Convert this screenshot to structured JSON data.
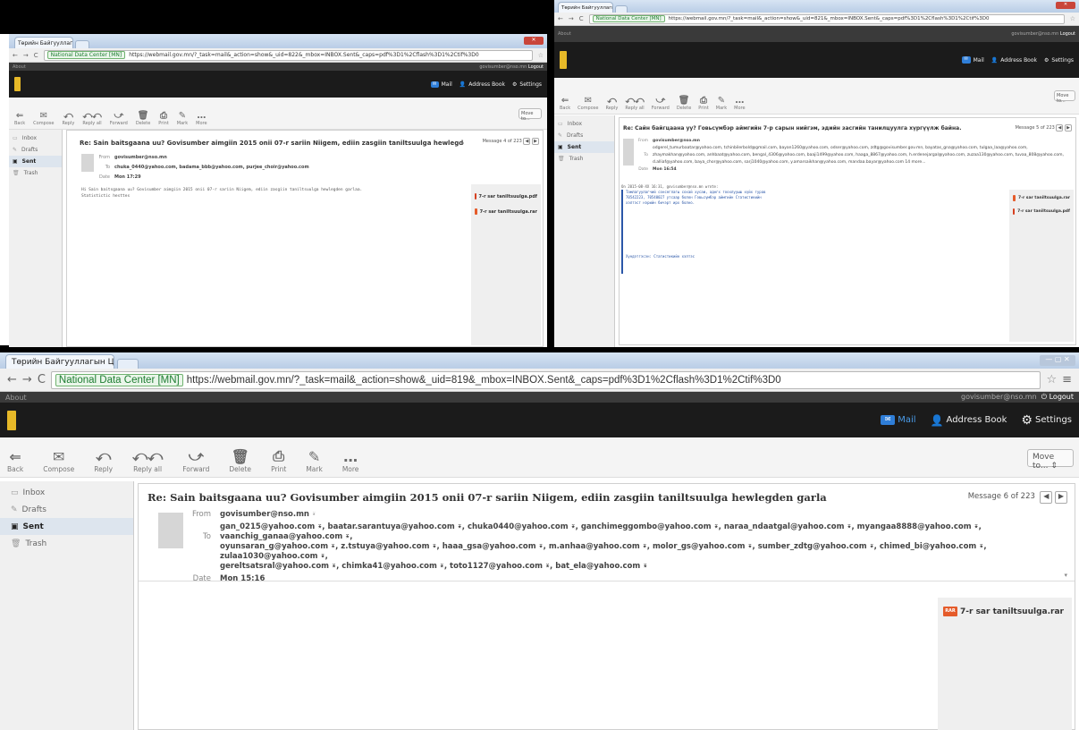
{
  "browser": {
    "tab_title": "Төрийн Байгууллагын Ц",
    "tab_close": "×",
    "url_secure_label": "National Data Center [MN]",
    "url": "https://webmail.gov.mn/?_task=mail&_action=show&_uid=819&_mbox=INBOX.Sent&_caps=pdf%3D1%2Cflash%3D1%2Ctif%3D0",
    "url_left": "https://webmail.gov.mn/?_task=mail&_action=show&_uid=822&_mbox=INBOX.Sent&_caps=pdf%3D1%2Cflash%3D1%2Ctif%3D0",
    "url_right": "https://webmail.gov.mn/?_task=mail&_action=show&_uid=821&_mbox=INBOX.Sent&_caps=pdf%3D1%2Cflash%3D1%2Ctif%3D0"
  },
  "app": {
    "about": "About",
    "user": "govisumber@nso.mn",
    "logout": "Logout",
    "nav": {
      "mail": "Mail",
      "address_book": "Address Book",
      "settings": "Settings"
    }
  },
  "toolbar": {
    "back": "Back",
    "compose": "Compose",
    "reply": "Reply",
    "reply_all": "Reply all",
    "forward": "Forward",
    "delete": "Delete",
    "print": "Print",
    "mark": "Mark",
    "more": "More",
    "move_to": "Move to..."
  },
  "folders": [
    "Inbox",
    "Drafts",
    "Sent",
    "Trash"
  ],
  "labels": {
    "from": "From",
    "to": "To",
    "date": "Date"
  },
  "screens": {
    "left": {
      "subject": "Re: Sain baitsgaana uu? Govisumber aimgiin 2015 onii 07-r sariin Niigem, ediin zasgiin taniltsuulga hewlegden garlaa.",
      "message_count": "Message 4 of 223",
      "from": "govisumber@nso.mn",
      "to": "chuka_0440@yahoo.com, badama_bbb@yahoo.com, purjee_choir@yahoo.com",
      "date": "Mon 17:29",
      "body_line1": "Hi Sain baitsgaana uu? Govisumber aimgiin 2015 onii 07-r sariin Niigem, ediin zasgiin taniltsuulga hewlegden garlaa.",
      "body_line2": "Statistictic hesttes",
      "attachments": [
        "7-r sar taniltsuulga.pdf",
        "7-r sar taniltsuulga.rar"
      ]
    },
    "right": {
      "subject": "Re: Сайн байгцаана уу? Говьсүмбэр аймгийн 7-р сарын нийгэм, эдийн засгийн танилцуулга хүргүүлж байна.",
      "message_count": "Message 5 of 223",
      "from": "govisumber@nso.mn",
      "to": "odgerel_tumurbaatar@yahoo.com, tchinbilerbold@gmail.com, bayan1260@yahoo.com, odser@yahoo.com, zdtg@govisumber.gov.mn, bayatas_gna@yahoo.com, tulgaa_laa@yahoo.com, zhaymakhan@yahoo.com, anhbaat@yahoo.com, bengal_4306@yahoo.com, baaji1499@yahoo.com, haaga_8867@yahoo.com, h.erdenejargal@yahoo.com, zuzaa130@yahoo.com, tuvaa_808@yahoo.com, d.alliaf@yahoo.com, baya_chor@yahoo.com, sarj1040@yahoo.com, y.amarsaikhan@yahoo.com, mandaa.bayar@yahoo.com 14 more...",
      "date": "Mon 16:54",
      "quote_header": "On 2015-08-XX 16:31, govisumber@nso.mn wrote:",
      "quote_line1": "Тамлагуулагчий сонсеглагы сохай хусаж, аднгх тоохлууыш хүйх гурав",
      "quote_line2": "70542223, 70540027 утсаар болон Говьсүмбэр аймгийн Статистикийн",
      "quote_line3": "хэлтэст нэрийн бичэрт ирх болно.",
      "signature": "Хүндэтгэсэн: Статистикийн хэлтэс",
      "attachments": [
        "7-r sar taniltsuulga.rar",
        "7-r sar taniltsuulga.pdf"
      ]
    },
    "main": {
      "subject": "Re: Sain baitsgaana uu? Govisumber aimgiin 2015 onii 07-r sariin Niigem, ediin zasgiin taniltsuulga hewlegden garlaa.",
      "message_count": "Message 6 of 223",
      "from": "govisumber@nso.mn",
      "to_line1": "gan_0215@yahoo.com ⍣, baatar.sarantuya@yahoo.com ⍣, chuka0440@yahoo.com ⍣, ganchimeggombo@yahoo.com ⍣, naraa_ndaatgal@yahoo.com ⍣, myangaa8888@yahoo.com ⍣, vaanchig_ganaa@yahoo.com ⍣,",
      "to_line2": "oyunsaran_g@yahoo.com ⍣, z.tstuya@yahoo.com ⍣, haaa_gsa@yahoo.com ⍣, m.anhaa@yahoo.com ⍣, molor_gs@yahoo.com ⍣, sumber_zdtg@yahoo.com ⍣, chimed_bi@yahoo.com ⍣, zulaa1030@yahoo.com ⍣,",
      "to_line3": "gereltsatsral@yahoo.com ⍣, chimka41@yahoo.com ⍣, toto1127@yahoo.com ⍣, bat_ela@yahoo.com ⍣",
      "date": "Mon 15:16",
      "attachment": "7-r sar taniltsuulga.rar",
      "rar_badge": "RAR"
    }
  },
  "colors": {
    "accent": "#2f7ed8",
    "dark_header": "#1b1b1b",
    "logo": "#e7b928",
    "rar": "#e55b2a"
  }
}
